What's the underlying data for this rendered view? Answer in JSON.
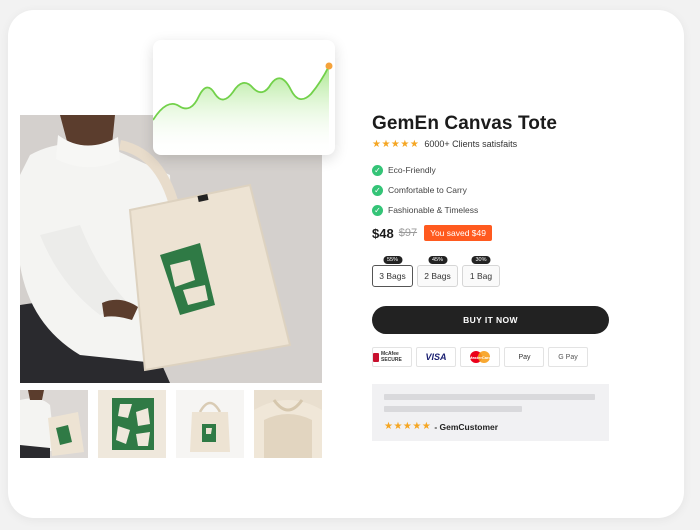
{
  "product": {
    "title": "GemEn Canvas Tote",
    "stars": "★★★★★",
    "rating_text": "6000+ Clients satisfaits",
    "features": [
      "Eco-Friendly",
      "Comfortable to Carry",
      "Fashionable & Timeless"
    ],
    "check_glyph": "✓",
    "price": "$48",
    "old_price": "$97",
    "saved_badge": "You saved $49"
  },
  "bundles": [
    {
      "label": "3 Bags",
      "badge": "55%",
      "selected": true
    },
    {
      "label": "2 Bags",
      "badge": "45%",
      "selected": false
    },
    {
      "label": "1 Bag",
      "badge": "30%",
      "selected": false
    }
  ],
  "buy_button": "BUY IT NOW",
  "payments": [
    {
      "name": "mcafee-secure-badge",
      "label": "McAfee SECURE"
    },
    {
      "name": "visa-badge",
      "label": "VISA"
    },
    {
      "name": "mastercard-badge",
      "label": "MasterCard"
    },
    {
      "name": "apple-pay-badge",
      "label": "Pay"
    },
    {
      "name": "google-pay-badge",
      "label": "G Pay"
    }
  ],
  "review": {
    "stars": "★★★★★",
    "author": "- GemCustomer"
  },
  "colors": {
    "accent_orange": "#ff5a1f",
    "check_green": "#34c477",
    "star_gold": "#f5a623",
    "chart_green": "#7ed957",
    "dark": "#222222"
  }
}
